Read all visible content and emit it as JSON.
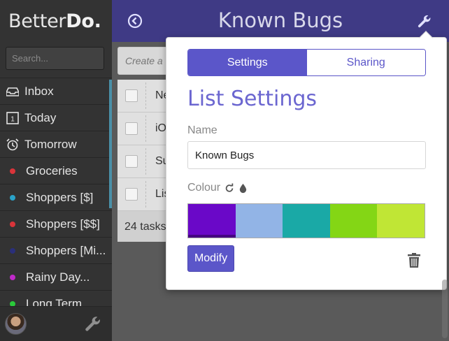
{
  "sidebar": {
    "brand": {
      "light": "Better",
      "bold": "Do."
    },
    "search_placeholder": "Search...",
    "items": [
      {
        "label": "Inbox",
        "icon": "inbox-icon"
      },
      {
        "label": "Today",
        "icon": "calendar-day-icon"
      },
      {
        "label": "Tomorrow",
        "icon": "alarm-clock-icon"
      },
      {
        "label": "Groceries",
        "color": "#d9343a"
      },
      {
        "label": "Shoppers [$]",
        "color": "#2aa3c9"
      },
      {
        "label": "Shoppers [$$]",
        "color": "#d9343a"
      },
      {
        "label": "Shoppers [Mi...",
        "color": "#2a2f7a"
      },
      {
        "label": "Rainy Day...",
        "color": "#c02ac9"
      },
      {
        "label": "Long Term",
        "color": "#2ac93a"
      }
    ]
  },
  "header": {
    "title": "Known Bugs"
  },
  "main": {
    "create_placeholder": "Create a task",
    "tasks": [
      {
        "label": "Ne"
      },
      {
        "label": "iO"
      },
      {
        "label": "Su"
      },
      {
        "label": "Lis"
      }
    ],
    "task_count": "24 tasks"
  },
  "popover": {
    "tabs": [
      {
        "label": "Settings",
        "active": true
      },
      {
        "label": "Sharing",
        "active": false
      }
    ],
    "title": "List Settings",
    "name_label": "Name",
    "name_value": "Known Bugs",
    "colour_label": "Colour",
    "swatches": [
      "#6a08c8",
      "#92b4e6",
      "#1aa9a6",
      "#84d615",
      "#c0e635"
    ],
    "modify_label": "Modify"
  },
  "colors": {
    "accent": "#5b56c9",
    "header_bg": "#3f3a85",
    "sidebar_bg": "#333333"
  }
}
